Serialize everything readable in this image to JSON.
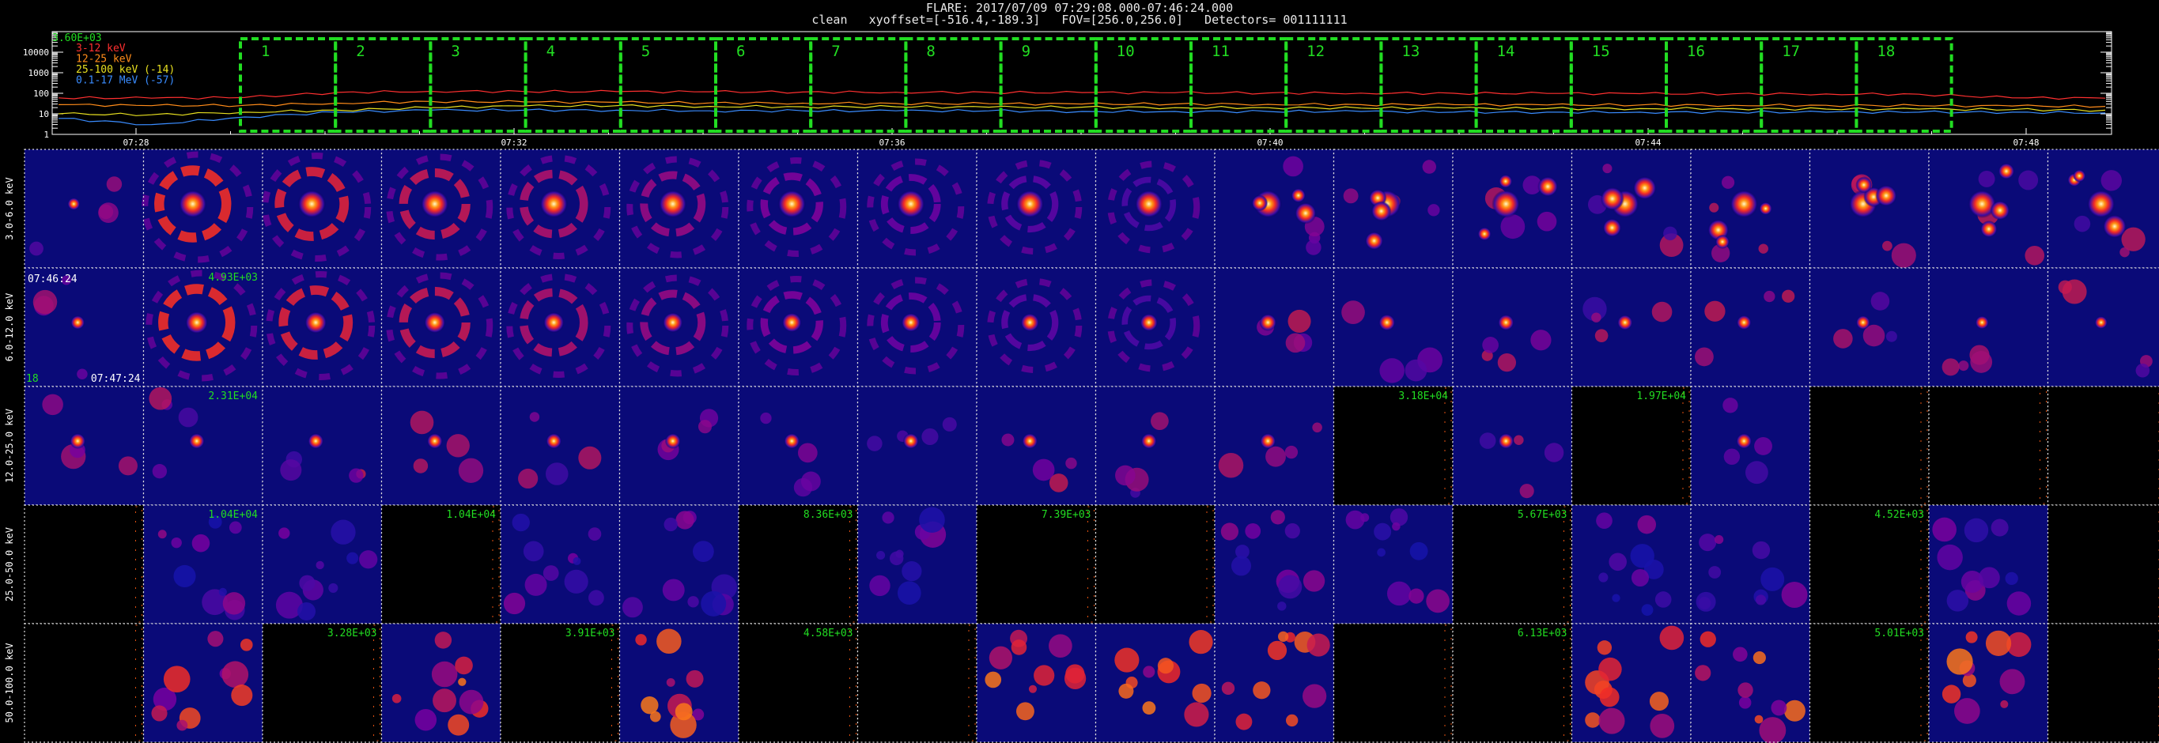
{
  "header": {
    "line1": "FLARE: 2017/07/09 07:29:08.000-07:46:24.000",
    "line2": "clean   xyoffset=[-516.4,-189.3]   FOV=[256.0,256.0]   Detectors= 001111111"
  },
  "chart_data": [
    {
      "type": "line",
      "yscale": "log",
      "ylim": [
        1,
        100000
      ],
      "y_tick_labels": [
        "1",
        "10",
        "100",
        "1000",
        "10000"
      ],
      "x_tick_labels": [
        "07:28",
        "07:32",
        "07:36",
        "07:40",
        "07:44",
        "07:48"
      ],
      "peak_label": "3.60E+03",
      "colors": {
        "3-12": "#ff3030",
        "12-25": "#ff8c1a",
        "25-100": "#e8e020",
        "0.1-17": "#3a8cff",
        "interval": "#22dd22"
      },
      "series": [
        {
          "name": "3-12 keV",
          "values": [
            60,
            58,
            62,
            110,
            125,
            123,
            120,
            118,
            115,
            112,
            110,
            108,
            106,
            104,
            102,
            100,
            98,
            96,
            94,
            92,
            90,
            60,
            58
          ]
        },
        {
          "name": "12-25 keV",
          "values": [
            28,
            25,
            26,
            33,
            40,
            38,
            36,
            34,
            33,
            32,
            31,
            30,
            30,
            29,
            28,
            28,
            27,
            27,
            26,
            26,
            25,
            24,
            23
          ]
        },
        {
          "name": "25-100 keV (-14)",
          "values": [
            10,
            9,
            12,
            15,
            20,
            24,
            25,
            23,
            22,
            22,
            21,
            21,
            20,
            20,
            19,
            19,
            18,
            18,
            18,
            17,
            17,
            16,
            15
          ]
        },
        {
          "name": "0.1-17 MeV (-57)",
          "values": [
            6,
            3,
            7,
            12,
            15,
            15,
            15,
            14,
            14,
            14,
            14,
            13,
            13,
            13,
            13,
            12,
            12,
            12,
            12,
            12,
            12,
            12,
            11
          ]
        }
      ],
      "intervals": [
        "1",
        "2",
        "3",
        "4",
        "5",
        "6",
        "7",
        "8",
        "9",
        "10",
        "11",
        "12",
        "13",
        "14",
        "15",
        "16",
        "17",
        "18"
      ]
    },
    {
      "type": "heatmap",
      "row_labels": [
        "3.0-6.0 keV",
        "6.0-12.0 keV",
        "12.0-25.0 keV",
        "25.0-50.0 keV",
        "50.0-100.0 keV"
      ],
      "columns": 18,
      "first_column_time_labels": {
        "start": "07:46:24",
        "end": "07:47:24",
        "index": "18"
      },
      "image_flags": [
        [
          1,
          1,
          1,
          1,
          1,
          1,
          1,
          1,
          1,
          1,
          1,
          1,
          1,
          1,
          1,
          1,
          1,
          1
        ],
        [
          1,
          1,
          1,
          1,
          1,
          1,
          1,
          1,
          1,
          1,
          1,
          1,
          1,
          1,
          1,
          1,
          1,
          1
        ],
        [
          1,
          1,
          1,
          1,
          1,
          1,
          1,
          1,
          1,
          1,
          0,
          1,
          0,
          1,
          0,
          0,
          0,
          0
        ],
        [
          1,
          1,
          0,
          1,
          1,
          0,
          1,
          0,
          0,
          1,
          1,
          0,
          1,
          1,
          0,
          1,
          0,
          0
        ],
        [
          1,
          0,
          1,
          0,
          1,
          0,
          0,
          1,
          1,
          1,
          0,
          0,
          1,
          1,
          0,
          1,
          0,
          0
        ]
      ],
      "annotations": [
        {
          "row": 2,
          "col": 1,
          "text": "2.31E+04"
        },
        {
          "row": 2,
          "col": 11,
          "text": "3.18E+04"
        },
        {
          "row": 2,
          "col": 13,
          "text": "1.97E+04"
        },
        {
          "row": 3,
          "col": 1,
          "text": "1.04E+04"
        },
        {
          "row": 3,
          "col": 3,
          "text": "1.04E+04"
        },
        {
          "row": 3,
          "col": 6,
          "text": "8.36E+03"
        },
        {
          "row": 3,
          "col": 8,
          "text": "7.39E+03"
        },
        {
          "row": 3,
          "col": 12,
          "text": "5.67E+03"
        },
        {
          "row": 3,
          "col": 15,
          "text": "4.52E+03"
        },
        {
          "row": 4,
          "col": 2,
          "text": "3.28E+03"
        },
        {
          "row": 4,
          "col": 4,
          "text": "3.91E+03"
        },
        {
          "row": 4,
          "col": 6,
          "text": "4.58E+03"
        },
        {
          "row": 4,
          "col": 12,
          "text": "6.13E+03"
        },
        {
          "row": 4,
          "col": 15,
          "text": "5.01E+03"
        },
        {
          "row": 1,
          "col": 1,
          "text": "4.93E+03"
        }
      ]
    }
  ]
}
